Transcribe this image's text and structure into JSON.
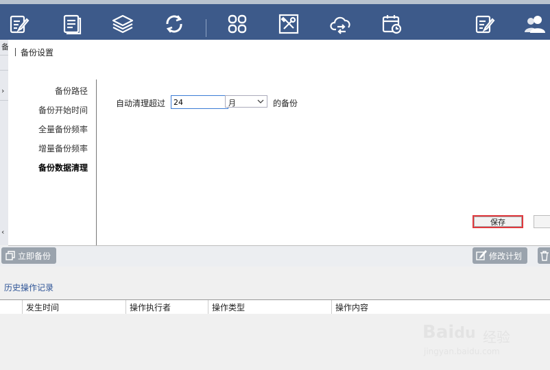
{
  "toolbar": {
    "icons": [
      "edit-note-icon",
      "document-icon",
      "layers-icon",
      "sync-icon",
      "apps-grid-icon",
      "tools-icon",
      "cloud-sync-icon",
      "calendar-clock-icon",
      "edit-list-icon",
      "users-icon"
    ]
  },
  "left_strip": {
    "top_char": "备",
    "arrow": "›",
    "bottom_char": "‹"
  },
  "dialog": {
    "title": "备份设置",
    "nav": [
      "备份路径",
      "备份开始时间",
      "全量备份频率",
      "增量备份频率",
      "备份数据清理"
    ],
    "active_nav": "备份数据清理",
    "form": {
      "label": "自动清理超过",
      "value": "24",
      "unit": "月",
      "suffix": "的备份"
    },
    "save_label": "保存"
  },
  "actions": {
    "backup_now": "立即备份",
    "modify_plan": "修改计划"
  },
  "history": {
    "title": "历史操作记录",
    "columns": [
      "发生时间",
      "操作执行者",
      "操作类型",
      "操作内容"
    ]
  },
  "colors": {
    "toolbar": "#3d5a8a",
    "highlight": "#e0393e",
    "link": "#2f5597"
  }
}
